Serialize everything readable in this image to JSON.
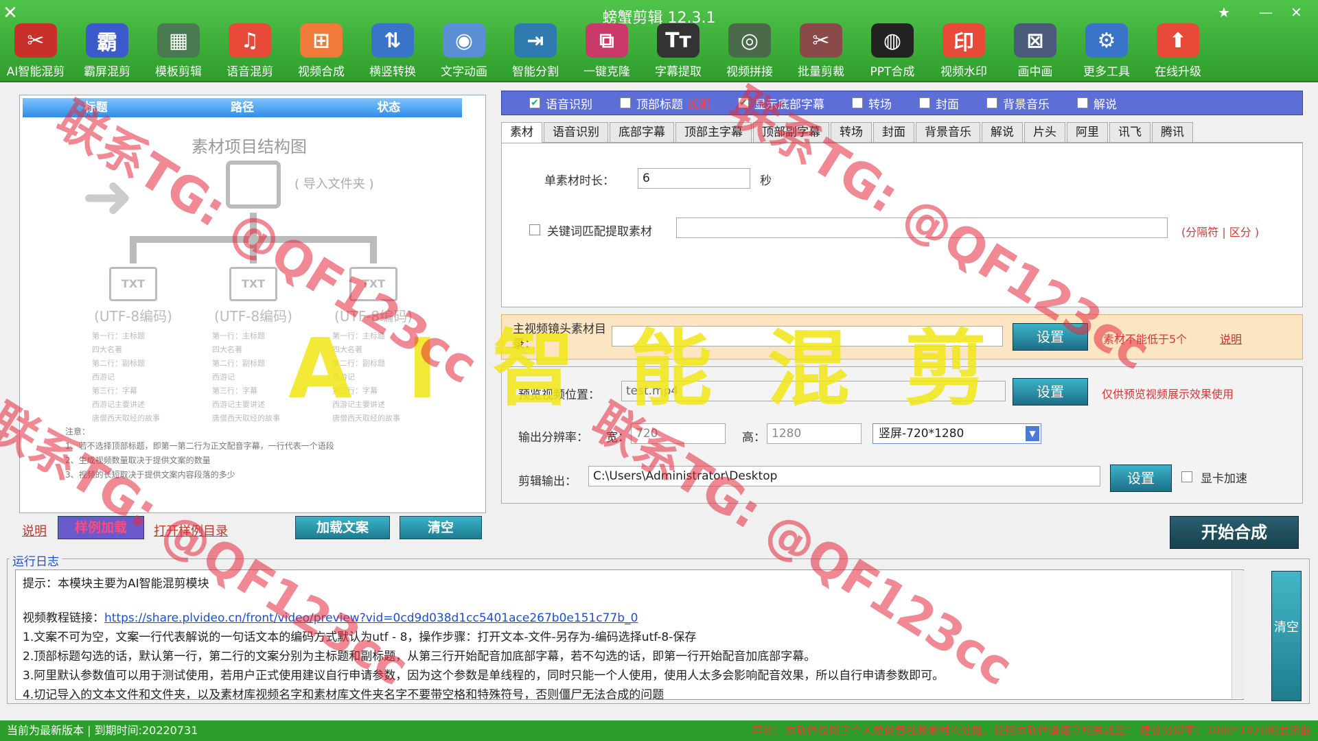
{
  "window": {
    "title": "螃蟹剪辑 12.3.1",
    "minimize": "—",
    "close": "✕"
  },
  "toolbar": [
    {
      "label": "AI智能混剪",
      "icon": "ai-mix-icon",
      "glyph": "✂",
      "color": "#c9302c"
    },
    {
      "label": "霸屏混剪",
      "icon": "bapin-icon",
      "glyph": "霸",
      "color": "#3b5bcb"
    },
    {
      "label": "模板剪辑",
      "icon": "template-icon",
      "glyph": "▦",
      "color": "#4a7a50"
    },
    {
      "label": "语音混剪",
      "icon": "music-icon",
      "glyph": "♫",
      "color": "#e84a3a"
    },
    {
      "label": "视频合成",
      "icon": "video-merge-icon",
      "glyph": "⊞",
      "color": "#f07a3a"
    },
    {
      "label": "横竖转换",
      "icon": "rotate-icon",
      "glyph": "⇅",
      "color": "#3a74c9"
    },
    {
      "label": "文字动画",
      "icon": "text-anim-icon",
      "glyph": "◉",
      "color": "#5a8fd6"
    },
    {
      "label": "智能分割",
      "icon": "split-icon",
      "glyph": "⇥",
      "color": "#2f7bb0"
    },
    {
      "label": "一键克隆",
      "icon": "clone-icon",
      "glyph": "⧉",
      "color": "#c93a6a"
    },
    {
      "label": "字幕提取",
      "icon": "subtitle-icon",
      "glyph": "Tт",
      "color": "#333333"
    },
    {
      "label": "视频拼接",
      "icon": "video-join-icon",
      "glyph": "◎",
      "color": "#4a6a4a"
    },
    {
      "label": "批量剪裁",
      "icon": "crop-icon",
      "glyph": "✂",
      "color": "#8a4a4a"
    },
    {
      "label": "PPT合成",
      "icon": "ppt-icon",
      "glyph": "◍",
      "color": "#222222"
    },
    {
      "label": "视频水印",
      "icon": "watermark-icon",
      "glyph": "印",
      "color": "#e84a3a"
    },
    {
      "label": "画中画",
      "icon": "pip-icon",
      "glyph": "⊠",
      "color": "#4a5a7a"
    },
    {
      "label": "更多工具",
      "icon": "more-tools-icon",
      "glyph": "⚙",
      "color": "#3a74c9"
    },
    {
      "label": "在线升级",
      "icon": "upgrade-icon",
      "glyph": "⬆",
      "color": "#e84a3a"
    }
  ],
  "left": {
    "columns": [
      "标题",
      "路径",
      "状态"
    ],
    "diagram": {
      "title": "素材项目结构图",
      "import_label": "( 导入文件夹 )",
      "txt": "TXT",
      "encoding": "(UTF-8编码)",
      "lines": [
        "第一行：主标题",
        "四大名著",
        "第二行：副标题",
        "西游记",
        "第三行：字幕",
        "西游记主要讲述",
        "唐僧西天取经的故事"
      ]
    },
    "notes": [
      "注意：",
      "1、若不选择顶部标题，即第一第二行为正文配音字幕，一行代表一个语段",
      "2、生成视频数量取决于提供文案的数量",
      "3、视频的长短取决于提供文案内容段落的多少"
    ],
    "actions": {
      "help": "说明",
      "load_sample": "样例加载",
      "open_sample_dir": "打开样例目录",
      "load_copy": "加载文案",
      "clear": "清空"
    }
  },
  "right": {
    "options": [
      {
        "label": "语音识别",
        "checked": true
      },
      {
        "label": "顶部标题",
        "checked": false,
        "link": "说明"
      },
      {
        "label": "显示底部字幕",
        "checked": true
      },
      {
        "label": "转场",
        "checked": false
      },
      {
        "label": "封面",
        "checked": false
      },
      {
        "label": "背景音乐",
        "checked": false
      },
      {
        "label": "解说",
        "checked": false
      }
    ],
    "tabs": [
      "素材",
      "语音识别",
      "底部字幕",
      "顶部主字幕",
      "顶部副字幕",
      "转场",
      "封面",
      "背景音乐",
      "解说",
      "片头",
      "阿里",
      "讯飞",
      "腾讯"
    ],
    "active_tab": "素材",
    "duration_label": "单素材时长：",
    "duration_value": "6",
    "duration_unit": "秒",
    "keyword_label": "关键词匹配提取素材",
    "keyword_hint": "(分隔符 | 区分 )",
    "material_dir_label": "主视频镜头素材目录：",
    "material_set": "设置",
    "material_note": "素材不能低于5个",
    "material_help": "说明",
    "preview_label": "预览视频位置：",
    "preview_value": "test.mp4",
    "preview_set": "设置",
    "preview_note": "仅供预览视频展示效果使用",
    "resolution_label": "输出分辨率：",
    "width_label": "宽：",
    "width_value": "720",
    "height_label": "高：",
    "height_value": "1280",
    "resolution_preset": "竖屏-720*1280",
    "output_label": "剪辑输出：",
    "output_value": "C:\\Users\\Administrator\\Desktop",
    "output_set": "设置",
    "gpu_label": "显卡加速",
    "start": "开始合成"
  },
  "log": {
    "legend": "运行日志",
    "tip": "提示：本模块主要为AI智能混剪模块",
    "tutorial_prefix": "视频教程链接：",
    "tutorial_link": "https://share.plvideo.cn/front/video/preview?vid=0cd9d038d1cc5401ace267b0e151c77b_0",
    "line1": "1.文案不可为空，文案一行代表解说的一句话文本的编码方式默认为utf - 8，操作步骤：打开文本-文件-另存为-编码选择utf-8-保存",
    "line2": "2.顶部标题勾选的话，默认第一行，第二行的文案分别为主标题和副标题，从第三行开始配音加底部字幕，若不勾选的话，即第一行开始配音加底部字幕。",
    "line3": "3.阿里默认参数值可以用于测试使用，若用户正式使用建议自行申请参数，因为这个参数是单线程的，同时只能一个人使用，使用人太多会影响配音效果，所以自行申请参数即可。",
    "line4": "4.切记导入的文本文件和文件夹，以及素材库视频名字和素材库文件夹名字不要带空格和特殊符号，否则僵尸无法合成的问题",
    "clear": "清空"
  },
  "status": {
    "left": "当前为最新版本 | 到期时间:20220731",
    "right": "声明：本软件仅用于个人原创音视频素材的处理，使用本软件请遵守相关规定！  建议分辨率：1080*1920的显示器"
  },
  "overlay": {
    "banner": "AI智能混剪",
    "watermark": "联系TG: @QF123cc"
  }
}
